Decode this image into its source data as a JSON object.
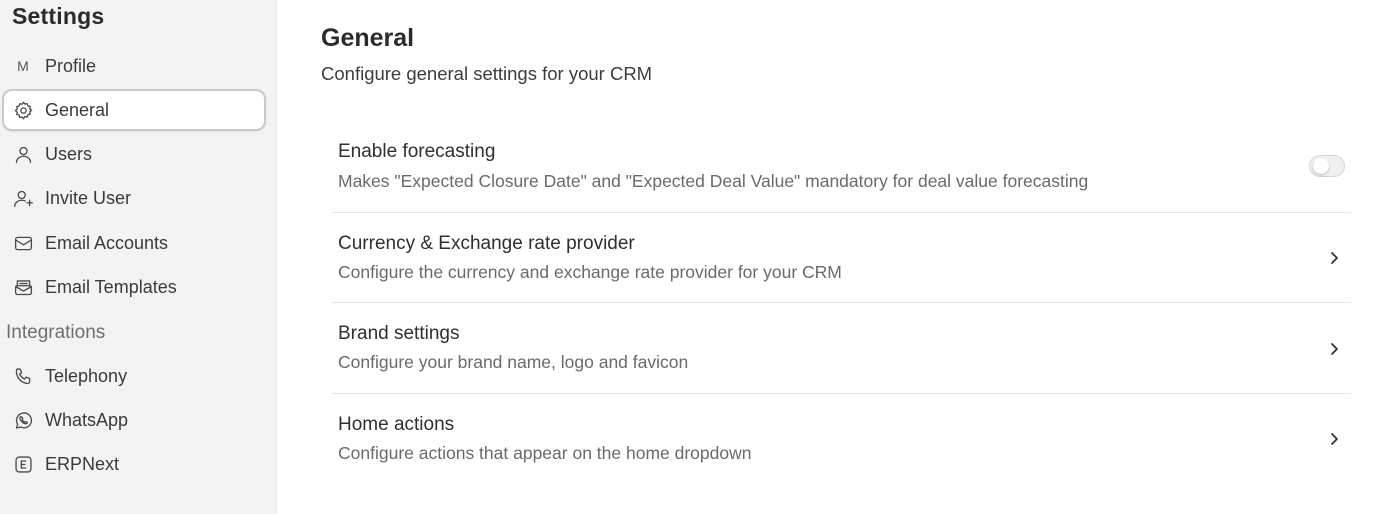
{
  "sidebar": {
    "title": "Settings",
    "items": [
      {
        "label": "Profile",
        "icon": "avatar-letter",
        "letter": "M",
        "active": false
      },
      {
        "label": "General",
        "icon": "gear-icon",
        "active": true
      },
      {
        "label": "Users",
        "icon": "user-icon",
        "active": false
      },
      {
        "label": "Invite User",
        "icon": "user-plus-icon",
        "active": false
      },
      {
        "label": "Email Accounts",
        "icon": "mail-icon",
        "active": false
      },
      {
        "label": "Email Templates",
        "icon": "mail-template-icon",
        "active": false
      }
    ],
    "integrations_heading": "Integrations",
    "integrations": [
      {
        "label": "Telephony",
        "icon": "phone-icon"
      },
      {
        "label": "WhatsApp",
        "icon": "whatsapp-icon"
      },
      {
        "label": "ERPNext",
        "icon": "erpnext-icon",
        "letter": "E"
      }
    ]
  },
  "main": {
    "title": "General",
    "subtitle": "Configure general settings for your CRM",
    "settings": [
      {
        "title": "Enable forecasting",
        "description": "Makes \"Expected Closure Date\" and \"Expected Deal Value\" mandatory for deal value forecasting",
        "control": "toggle",
        "enabled": false
      },
      {
        "title": "Currency & Exchange rate provider",
        "description": "Configure the currency and exchange rate provider for your CRM",
        "control": "chevron-right-icon"
      },
      {
        "title": "Brand settings",
        "description": "Configure your brand name, logo and favicon",
        "control": "chevron-right-icon"
      },
      {
        "title": "Home actions",
        "description": "Configure actions that appear on the home dropdown",
        "control": "chevron-right-icon"
      }
    ]
  },
  "colors": {
    "sidebar_bg": "#f3f3f3",
    "active_border": "#c9c9c9",
    "text_primary": "#2b2b2b",
    "text_secondary": "#6a6a6a",
    "divider": "#e6e6e6"
  }
}
